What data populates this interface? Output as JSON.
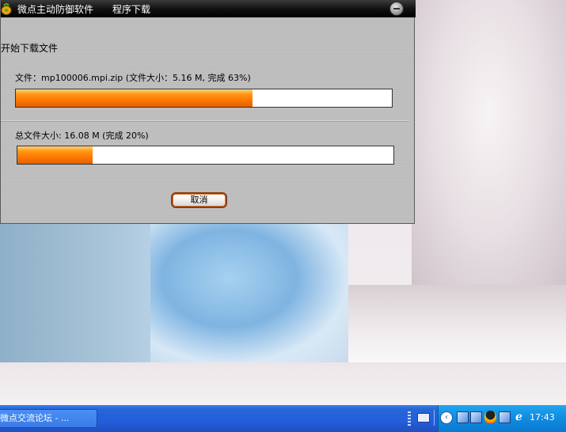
{
  "window": {
    "title": "微点主动防御软件",
    "menu": "程序下载",
    "heading": "开始下载文件",
    "file_label": "文件：mp100006.mpi.zip (文件大小：5.16 M, 完成 63%)",
    "total_label": "总文件大小: 16.08 M (完成 20%)",
    "file_progress": 63,
    "total_progress": 20,
    "cancel_label": "取消"
  },
  "taskbar": {
    "task_label": "微点交流论坛 - ...",
    "clock": "17:43"
  },
  "icons": {
    "app": "app-logo-icon",
    "close": "minimize-icon",
    "keyboard": "keyboard-icon",
    "tray_expand": "chevron-left-icon",
    "network": "network-icon",
    "qq": "qq-icon",
    "ie": "ie-icon"
  },
  "colors": {
    "progress_fill": "#ff7a00",
    "taskbar": "#245edb",
    "tray": "#0f8be0",
    "titlebar": "#000000"
  }
}
